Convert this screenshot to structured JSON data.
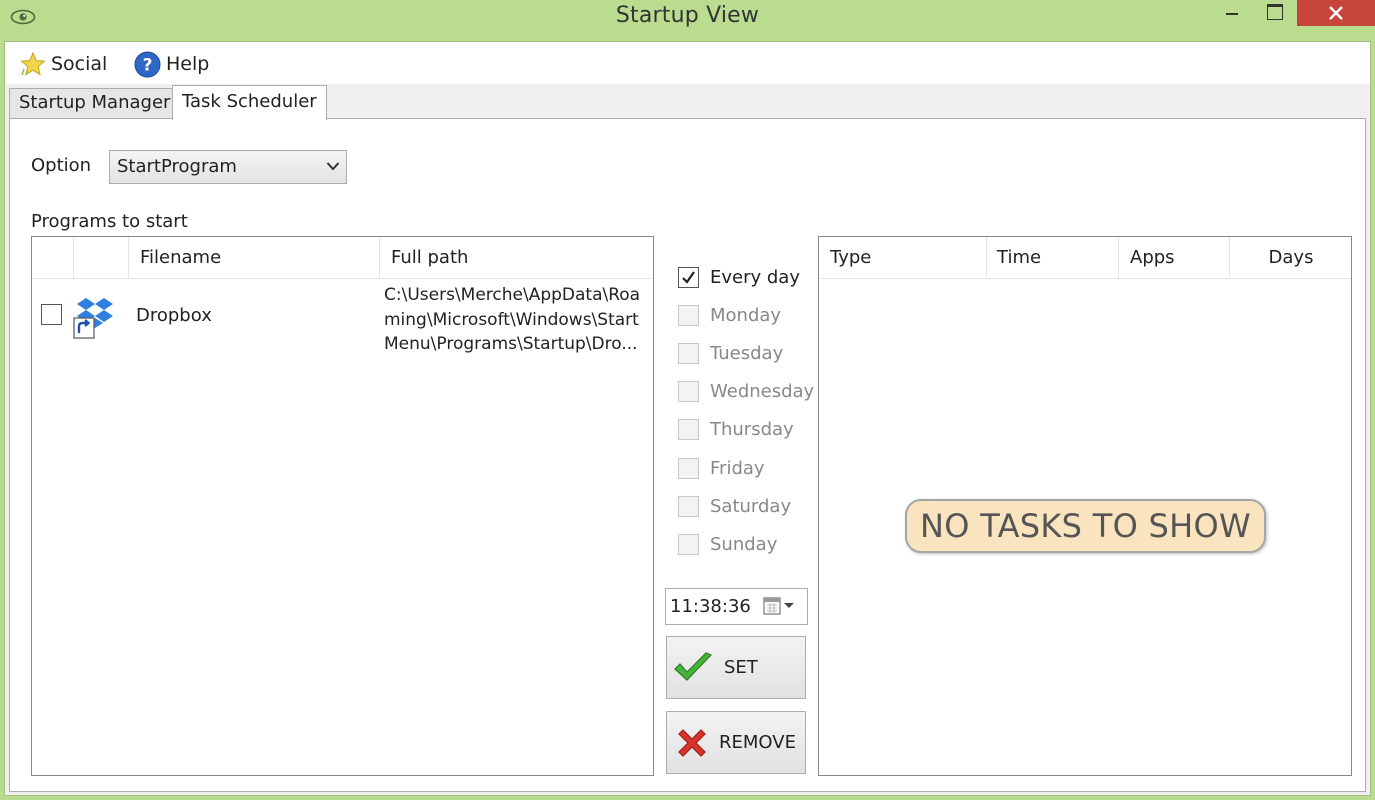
{
  "window": {
    "title": "Startup View"
  },
  "menu": {
    "social": "Social",
    "help": "Help"
  },
  "tabs": [
    {
      "label": "Startup Manager",
      "active": false
    },
    {
      "label": "Task Scheduler",
      "active": true
    }
  ],
  "option": {
    "label": "Option",
    "value": "StartProgram"
  },
  "programs": {
    "label": "Programs to start",
    "columns": [
      "Filename",
      "Full path"
    ],
    "rows": [
      {
        "checked": false,
        "icon": "dropbox-shortcut-icon",
        "filename": "Dropbox",
        "path_lines": [
          "C:\\Users\\Merche\\AppData\\Roa",
          "ming\\Microsoft\\Windows\\Start",
          "Menu\\Programs\\Startup\\Dro..."
        ]
      }
    ]
  },
  "days": [
    {
      "label": "Every day",
      "checked": true,
      "enabled": true
    },
    {
      "label": "Monday",
      "checked": false,
      "enabled": false
    },
    {
      "label": "Tuesday",
      "checked": false,
      "enabled": false
    },
    {
      "label": "Wednesday",
      "checked": false,
      "enabled": false
    },
    {
      "label": "Thursday",
      "checked": false,
      "enabled": false
    },
    {
      "label": "Friday",
      "checked": false,
      "enabled": false
    },
    {
      "label": "Saturday",
      "checked": false,
      "enabled": false
    },
    {
      "label": "Sunday",
      "checked": false,
      "enabled": false
    }
  ],
  "time": {
    "value": "11:38:36"
  },
  "buttons": {
    "set": "SET",
    "remove": "REMOVE"
  },
  "tasks": {
    "columns": [
      "Type",
      "Time",
      "Apps",
      "Days"
    ],
    "empty_message": "NO TASKS TO SHOW"
  },
  "colors": {
    "window_frame": "#b9dc8f",
    "close_button": "#c7443a",
    "empty_badge": "#fae3bf"
  }
}
